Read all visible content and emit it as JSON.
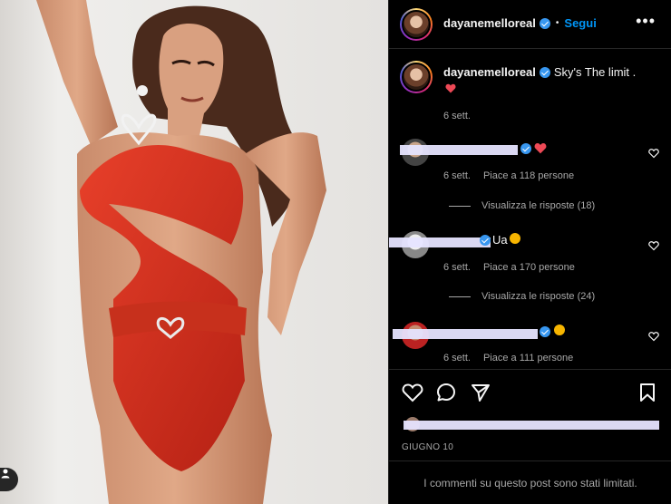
{
  "header": {
    "username": "dayanemelloreal",
    "separator": "•",
    "follow_label": "Segui",
    "more_label": "•••"
  },
  "caption": {
    "username": "dayanemelloreal",
    "text": "Sky's The limit .",
    "time": "6 sett."
  },
  "comments": [
    {
      "likes": "Piace a 118 persone",
      "time": "6 sett.",
      "replies": "Visualizza le risposte (18)"
    },
    {
      "text": "Ua",
      "likes": "Piace a 170 persone",
      "time": "6 sett.",
      "replies": "Visualizza le risposte (24)"
    },
    {
      "likes": "Piace a 111 persone",
      "time": "6 sett."
    }
  ],
  "post": {
    "date": "GIUGNO 10",
    "limited_notice": "I commenti su questo post sono stati limitati."
  },
  "colors": {
    "accent": "#0095f6",
    "heart": "#ed4956",
    "verified": "#3897f0",
    "redaction": "#e6e4ff"
  },
  "icons": [
    "heart-icon",
    "comment-icon",
    "share-icon",
    "bookmark-icon",
    "more-icon",
    "verified-icon",
    "user-tag-icon"
  ]
}
